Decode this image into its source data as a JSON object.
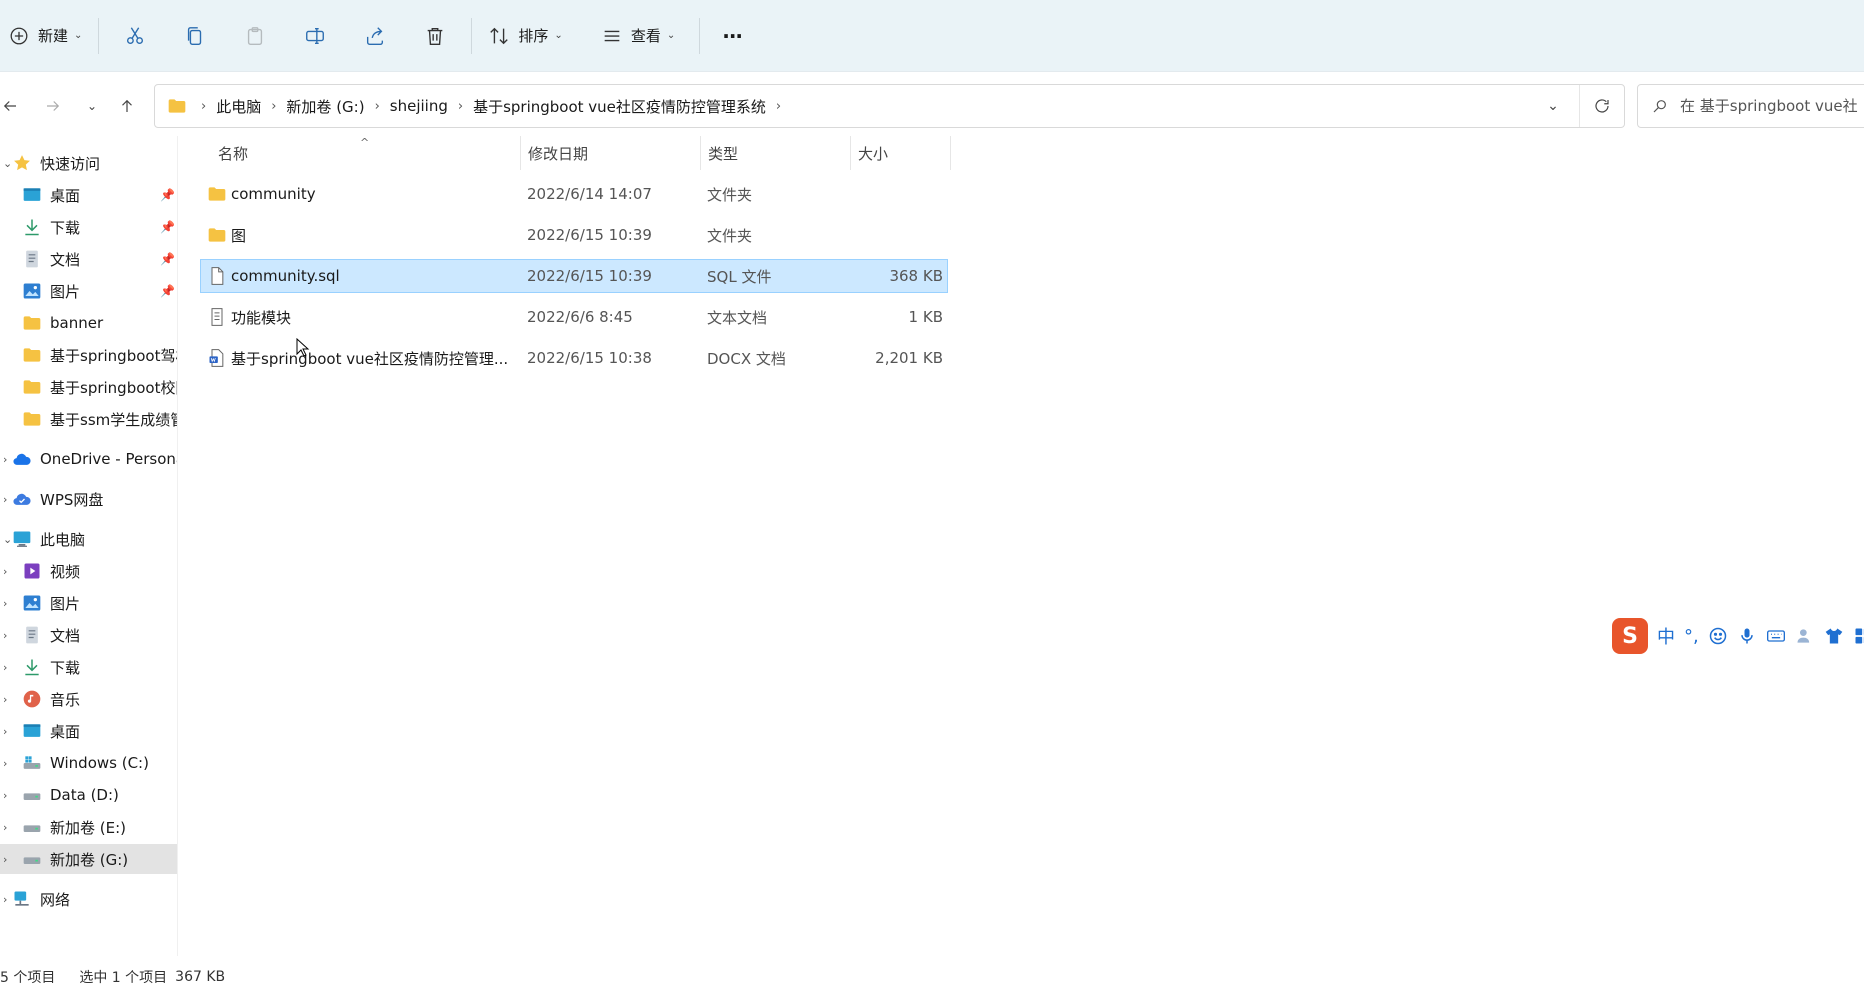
{
  "toolbar": {
    "new_label": "新建",
    "sort_label": "排序",
    "view_label": "查看",
    "more_label": "···"
  },
  "address": {
    "crumbs": [
      "此电脑",
      "新加卷 (G:)",
      "shejiing",
      "基于springboot vue社区疫情防控管理系统"
    ],
    "search_placeholder": "在 基于springboot vue社"
  },
  "sidebar": {
    "quick_access": "快速访问",
    "quick_items": [
      "桌面",
      "下载",
      "文档",
      "图片",
      "banner",
      "基于springboot驾校",
      "基于springboot校园",
      "基于ssm学生成绩管理"
    ],
    "onedrive": "OneDrive - Personal",
    "wps": "WPS网盘",
    "this_pc": "此电脑",
    "pc_items": [
      "视频",
      "图片",
      "文档",
      "下载",
      "音乐",
      "桌面",
      "Windows (C:)",
      "Data (D:)",
      "新加卷 (E:)",
      "新加卷 (G:)"
    ],
    "network": "网络"
  },
  "columns": {
    "name": "名称",
    "date": "修改日期",
    "type": "类型",
    "size": "大小"
  },
  "files": [
    {
      "name": "community",
      "date": "2022/6/14 14:07",
      "type": "文件夹",
      "size": "",
      "icon": "folder-icon"
    },
    {
      "name": "图",
      "date": "2022/6/15 10:39",
      "type": "文件夹",
      "size": "",
      "icon": "folder-icon"
    },
    {
      "name": "community.sql",
      "date": "2022/6/15 10:39",
      "type": "SQL 文件",
      "size": "368 KB",
      "icon": "file-icon"
    },
    {
      "name": "功能模块",
      "date": "2022/6/6 8:45",
      "type": "文本文档",
      "size": "1 KB",
      "icon": "text-file-icon"
    },
    {
      "name": "基于springboot vue社区疫情防控管理...",
      "date": "2022/6/15 10:38",
      "type": "DOCX 文档",
      "size": "2,201 KB",
      "icon": "docx-file-icon"
    }
  ],
  "status": {
    "count": "5 个项目",
    "selected": "选中 1 个项目",
    "selected_size": "367 KB"
  },
  "ime": {
    "logo": "S",
    "mode": "中",
    "punct": "°,"
  },
  "colors": {
    "toolbar_bg": "#eaf3f7",
    "selection_bg": "#cce8ff",
    "selection_border": "#99d1ff",
    "folder": "#f5c242",
    "ime_red": "#e8552b"
  }
}
